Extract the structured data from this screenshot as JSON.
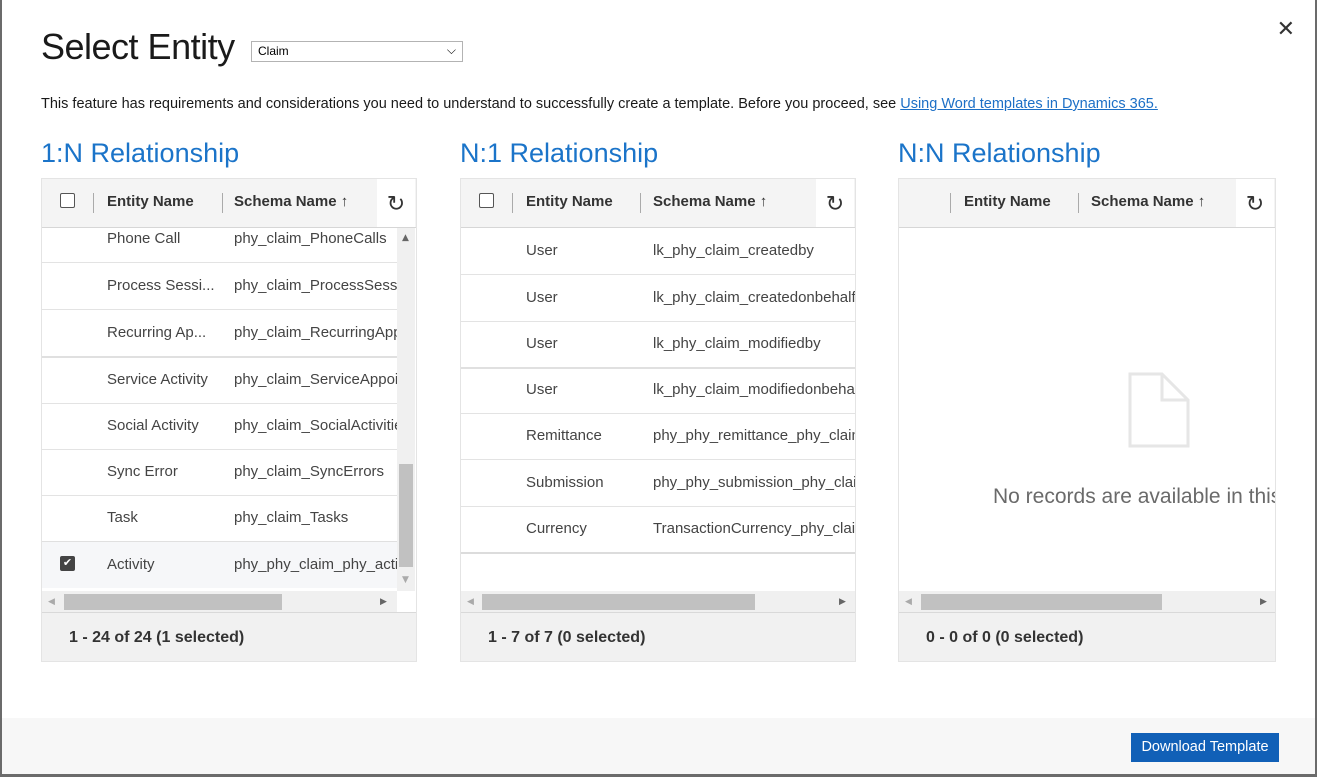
{
  "dialog": {
    "title": "Select Entity",
    "entity_select": {
      "value": "Claim"
    },
    "close_icon": "close-icon",
    "info_text": "This feature has requirements and considerations you need to understand to successfully create a template. Before you proceed, see ",
    "info_link": "Using Word templates in Dynamics 365.",
    "download_button": "Download Template"
  },
  "sections": [
    {
      "title": "1:N Relationship",
      "headers": {
        "entity": "Entity Name",
        "schema": "Schema Name ↑"
      },
      "rows": [
        {
          "entity": "Phone Call",
          "schema": "phy_claim_PhoneCalls",
          "selected": false
        },
        {
          "entity": "Process Sessi...",
          "schema": "phy_claim_ProcessSessions",
          "selected": false
        },
        {
          "entity": "Recurring Ap...",
          "schema": "phy_claim_RecurringAppointmentMasters",
          "selected": false
        },
        {
          "entity": "Service Activity",
          "schema": "phy_claim_ServiceAppointments",
          "selected": false
        },
        {
          "entity": "Social Activity",
          "schema": "phy_claim_SocialActivities",
          "selected": false
        },
        {
          "entity": "Sync Error",
          "schema": "phy_claim_SyncErrors",
          "selected": false
        },
        {
          "entity": "Task",
          "schema": "phy_claim_Tasks",
          "selected": false
        },
        {
          "entity": "Activity",
          "schema": "phy_phy_claim_phy_activity",
          "selected": true
        }
      ],
      "status": "1 - 24 of 24 (1 selected)"
    },
    {
      "title": "N:1 Relationship",
      "headers": {
        "entity": "Entity Name",
        "schema": "Schema Name ↑"
      },
      "rows": [
        {
          "entity": "User",
          "schema": "lk_phy_claim_createdby",
          "selected": false
        },
        {
          "entity": "User",
          "schema": "lk_phy_claim_createdonbehalfby",
          "selected": false
        },
        {
          "entity": "User",
          "schema": "lk_phy_claim_modifiedby",
          "selected": false
        },
        {
          "entity": "User",
          "schema": "lk_phy_claim_modifiedonbehalfby",
          "selected": false
        },
        {
          "entity": "Remittance",
          "schema": "phy_phy_remittance_phy_claim",
          "selected": false
        },
        {
          "entity": "Submission",
          "schema": "phy_phy_submission_phy_claim",
          "selected": false
        },
        {
          "entity": "Currency",
          "schema": "TransactionCurrency_phy_claim",
          "selected": false
        }
      ],
      "status": "1 - 7 of 7 (0 selected)"
    },
    {
      "title": "N:N Relationship",
      "headers": {
        "entity": "Entity Name",
        "schema": "Schema Name ↑"
      },
      "rows": [],
      "empty_text": "No records are available in this view.",
      "status": "0 - 0 of 0 (0 selected)"
    }
  ]
}
